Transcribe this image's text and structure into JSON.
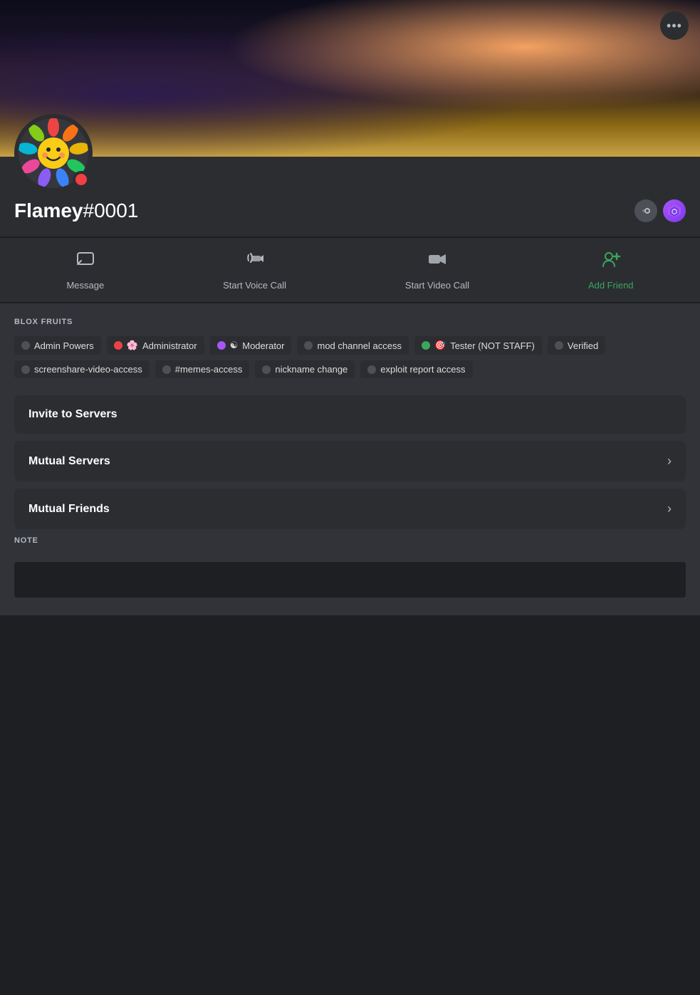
{
  "banner": {
    "more_btn_label": "•••"
  },
  "profile": {
    "avatar_emoji": "🌸",
    "username": "Flamey",
    "discriminator": "#0001",
    "status_color": "#f23f43",
    "badges": [
      {
        "id": "speed",
        "label": "🚀"
      },
      {
        "id": "hex",
        "label": "⬡"
      }
    ]
  },
  "actions": [
    {
      "id": "message",
      "icon": "message",
      "label": "Message"
    },
    {
      "id": "voice",
      "icon": "voice",
      "label": "Start Voice Call"
    },
    {
      "id": "video",
      "icon": "video",
      "label": "Start Video Call"
    },
    {
      "id": "friend",
      "icon": "friend",
      "label": "Add Friend",
      "color": "green"
    }
  ],
  "roles_section": {
    "title": "BLOX FRUITS",
    "roles": [
      {
        "id": "admin-powers",
        "dot": "grey",
        "label": "Admin Powers"
      },
      {
        "id": "administrator",
        "dot": "red",
        "emoji": "🌸",
        "label": "Administrator"
      },
      {
        "id": "moderator",
        "dot": "purple",
        "emoji": "☯",
        "label": "Moderator"
      },
      {
        "id": "mod-channel",
        "dot": "grey",
        "label": "mod channel access"
      },
      {
        "id": "tester",
        "dot": "green",
        "emoji": "🎯",
        "label": "Tester (NOT STAFF)"
      },
      {
        "id": "verified",
        "dot": "grey",
        "label": "Verified"
      },
      {
        "id": "screenshare",
        "dot": "grey",
        "label": "screenshare-video-access"
      },
      {
        "id": "memes",
        "dot": "grey",
        "label": "#memes-access"
      },
      {
        "id": "nickname",
        "dot": "grey",
        "label": "nickname change"
      },
      {
        "id": "exploit",
        "dot": "grey",
        "label": "exploit report access"
      }
    ]
  },
  "expandable": [
    {
      "id": "invite-servers",
      "label": "Invite to Servers",
      "has_arrow": false
    },
    {
      "id": "mutual-servers",
      "label": "Mutual Servers",
      "has_arrow": true
    },
    {
      "id": "mutual-friends",
      "label": "Mutual Friends",
      "has_arrow": true
    }
  ],
  "note": {
    "title": "NOTE",
    "placeholder": ""
  }
}
